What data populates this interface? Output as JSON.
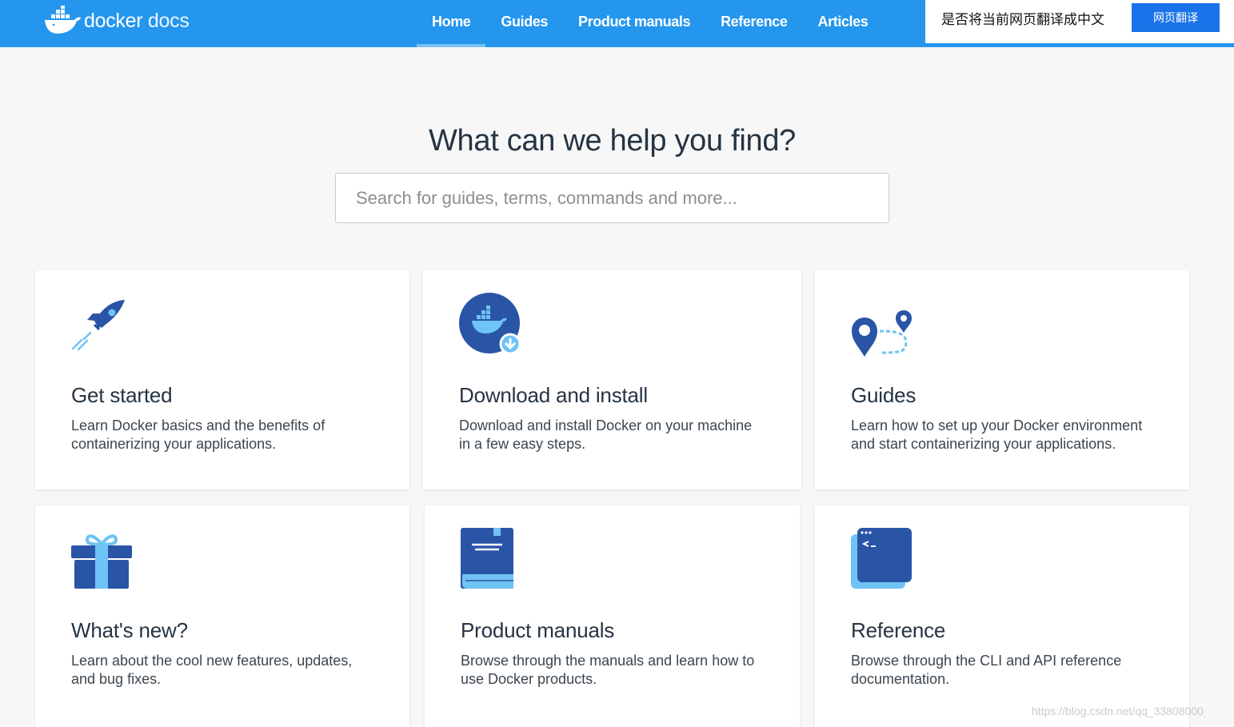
{
  "brand": {
    "name": "docker",
    "suffix": "docs",
    "color": "#2496ed"
  },
  "nav": {
    "items": [
      {
        "label": "Home",
        "active": true
      },
      {
        "label": "Guides"
      },
      {
        "label": "Product manuals"
      },
      {
        "label": "Reference"
      },
      {
        "label": "Articles"
      }
    ]
  },
  "translate": {
    "prompt": "是否将当前网页翻译成中文",
    "button": "网页翻译"
  },
  "hero": {
    "title": "What can we help you find?",
    "search_placeholder": "Search for guides, terms, commands and more..."
  },
  "cards": [
    {
      "icon": "rocket-icon",
      "title": "Get started",
      "description": "Learn Docker basics and the benefits of containerizing your applications."
    },
    {
      "icon": "docker-download-icon",
      "title": "Download and install",
      "description": "Download and install Docker on your machine in a few easy steps."
    },
    {
      "icon": "map-route-icon",
      "title": "Guides",
      "description": "Learn how to set up your Docker environment and start containerizing your applications."
    },
    {
      "icon": "gift-icon",
      "title": "What's new?",
      "description": "Learn about the cool new features, updates, and bug fixes."
    },
    {
      "icon": "book-icon",
      "title": "Product manuals",
      "description": "Browse through the manuals and learn how to use Docker products."
    },
    {
      "icon": "terminal-icon",
      "title": "Reference",
      "description": "Browse through the CLI and API reference documentation."
    }
  ],
  "watermark": "https://blog.csdn.net/qq_33808000",
  "colors": {
    "icon_dark": "#2a55a6",
    "icon_light": "#6fc3f5",
    "title_text": "#253443"
  }
}
